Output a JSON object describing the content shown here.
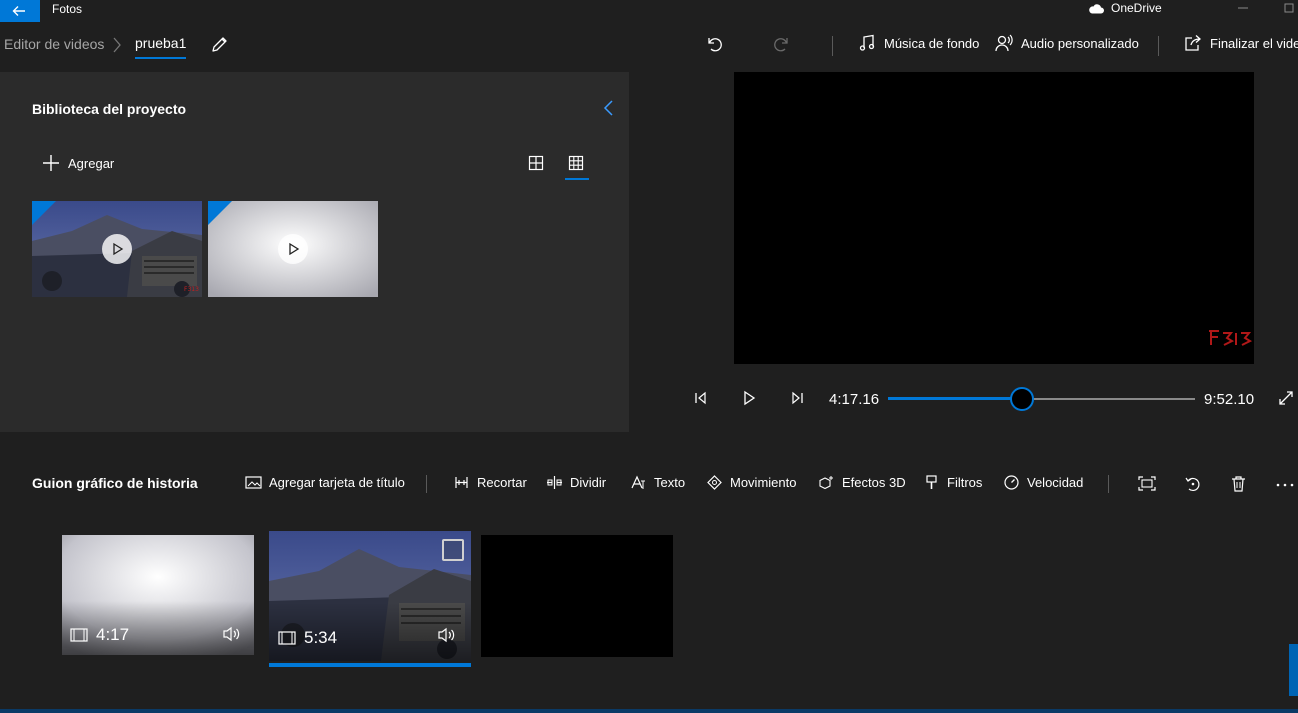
{
  "titlebar": {
    "app_name": "Fotos",
    "onedrive": "OneDrive"
  },
  "breadcrumb": {
    "root": "Editor de videos",
    "project": "prueba1"
  },
  "commands": {
    "background_music": "Música de fondo",
    "custom_audio": "Audio personalizado",
    "finish_video": "Finalizar el video"
  },
  "library": {
    "title": "Biblioteca del proyecto",
    "add_label": "Agregar"
  },
  "player": {
    "current_time": "4:17.16",
    "total_time": "9:52.10",
    "progress": 0.435
  },
  "storyboard": {
    "title": "Guion gráfico de historia",
    "tools": {
      "title_card": "Agregar tarjeta de título",
      "trim": "Recortar",
      "split": "Dividir",
      "text": "Texto",
      "motion": "Movimiento",
      "effects3d": "Efectos 3D",
      "filters": "Filtros",
      "speed": "Velocidad"
    },
    "clips": [
      {
        "duration": "4:17"
      },
      {
        "duration": "5:34"
      }
    ]
  },
  "colors": {
    "accent": "#0078d7",
    "panel": "#2b2b2b",
    "background": "#1f1f1f"
  }
}
